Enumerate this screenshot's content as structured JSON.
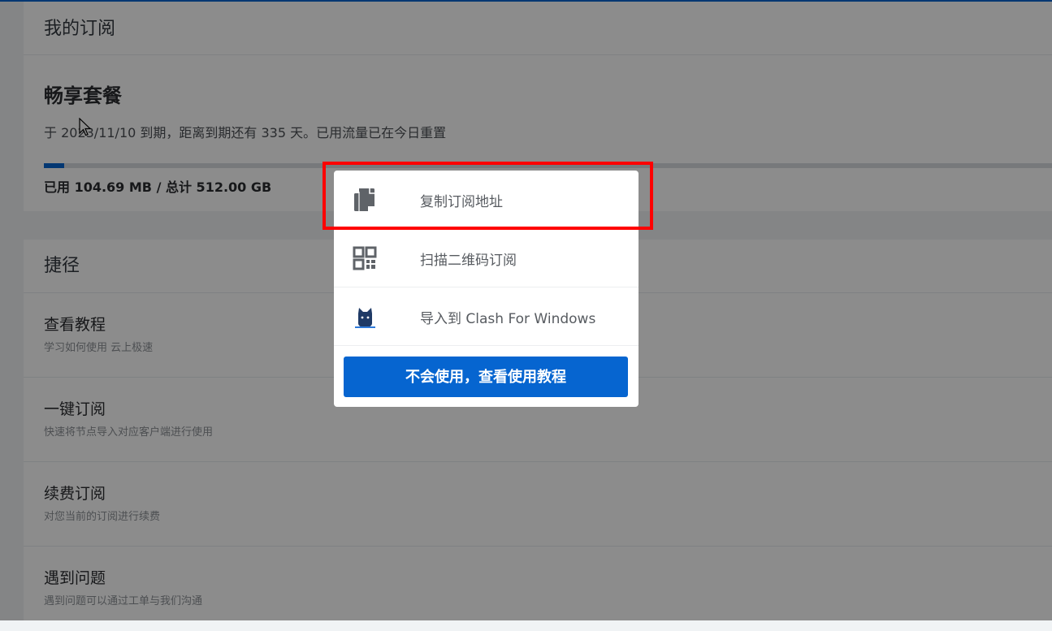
{
  "subscription": {
    "header": "我的订阅",
    "plan_name": "畅享套餐",
    "expiry_text": "于 2023/11/10 到期，距离到期还有 335 天。已用流量已在今日重置",
    "usage_text": "已用 104.69 MB / 总计 512.00 GB",
    "usage_fraction": 0.0002
  },
  "shortcuts": {
    "header": "捷径",
    "items": [
      {
        "title": "查看教程",
        "desc": "学习如何使用 云上极速"
      },
      {
        "title": "一键订阅",
        "desc": "快速将节点导入对应客户端进行使用"
      },
      {
        "title": "续费订阅",
        "desc": "对您当前的订阅进行续费"
      },
      {
        "title": "遇到问题",
        "desc": "遇到问题可以通过工单与我们沟通"
      }
    ]
  },
  "popup": {
    "items": [
      {
        "label": "复制订阅地址",
        "icon": "copy-icon"
      },
      {
        "label": "扫描二维码订阅",
        "icon": "qr-code-icon"
      },
      {
        "label": "导入到 Clash For Windows",
        "icon": "clash-cat-icon"
      }
    ],
    "button_label": "不会使用，查看使用教程"
  },
  "colors": {
    "accent": "#0665d0",
    "highlight": "#ff0000"
  }
}
